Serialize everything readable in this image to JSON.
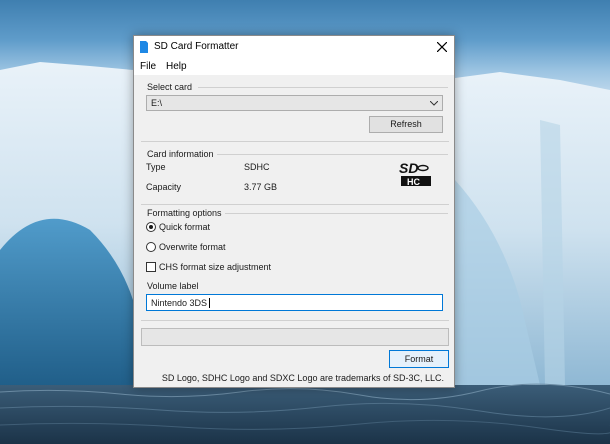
{
  "window": {
    "title": "SD Card Formatter",
    "icon": "sd-card-icon"
  },
  "menu": [
    "File",
    "Help"
  ],
  "select_card": {
    "label": "Select card",
    "value": "E:\\",
    "refresh_label": "Refresh"
  },
  "card_info": {
    "label": "Card information",
    "type_label": "Type",
    "type_value": "SDHC",
    "capacity_label": "Capacity",
    "capacity_value": "3.77 GB",
    "logo_top": "SD",
    "logo_bottom": "HC"
  },
  "formatting": {
    "label": "Formatting options",
    "quick_format": "Quick format",
    "overwrite_format": "Overwrite format",
    "selected": "quick",
    "chs_label": "CHS format size adjustment",
    "chs_checked": false,
    "volume_label_title": "Volume label",
    "volume_label_value": "Nintendo 3DS"
  },
  "progress": 0,
  "format_label": "Format",
  "footer": "SD Logo, SDHC Logo and SDXC Logo are trademarks of SD-3C, LLC.",
  "colors": {
    "accent": "#0078d7",
    "window_bg": "#f0f0f0",
    "app_icon": "#1e88e5"
  }
}
